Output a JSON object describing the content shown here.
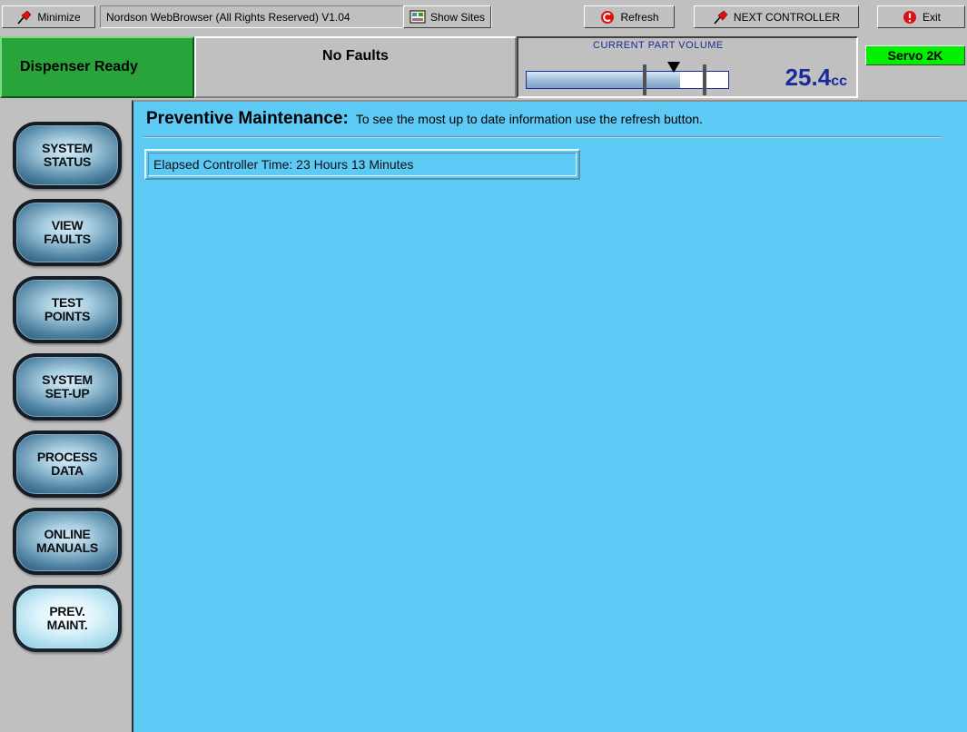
{
  "toolbar": {
    "minimize_label": "Minimize",
    "browser_title": "Nordson WebBrowser (All Rights Reserved) V1.04",
    "show_sites_label": "Show Sites",
    "refresh_label": "Refresh",
    "next_controller_label": "NEXT CONTROLLER",
    "exit_label": "Exit",
    "icons": {
      "minimize": "pin-icon",
      "show_sites": "sites-icon",
      "refresh": "refresh-icon",
      "next_controller": "pin-icon",
      "exit": "exit-icon"
    }
  },
  "status": {
    "ready_text": "Dispenser Ready",
    "faults_text": "No Faults",
    "volume_label": "CURRENT PART VOLUME",
    "volume_value": "25.4",
    "volume_unit": "cc",
    "volume_fill_fraction": 0.76,
    "lower_limit_fraction": 0.585,
    "upper_limit_fraction": 0.885,
    "pointer_fraction": 0.73,
    "servo_label": "Servo 2K"
  },
  "sidebar": {
    "items": [
      {
        "label": "SYSTEM\nSTATUS",
        "active": false
      },
      {
        "label": "VIEW\nFAULTS",
        "active": false
      },
      {
        "label": "TEST\nPOINTS",
        "active": false
      },
      {
        "label": "SYSTEM\nSET-UP",
        "active": false
      },
      {
        "label": "PROCESS\nDATA",
        "active": false
      },
      {
        "label": "ONLINE\nMANUALS",
        "active": false
      },
      {
        "label": "PREV.\nMAINT.",
        "active": true
      }
    ]
  },
  "main": {
    "title": "Preventive Maintenance:",
    "subtitle": "To see the most up to date information use the refresh button.",
    "elapsed_text": "Elapsed Controller Time: 23 Hours 13 Minutes"
  },
  "colors": {
    "ready_green": "#28a43a",
    "servo_green": "#00f000",
    "main_background": "#5dcaf6",
    "volume_blue": "#1a2a9a"
  }
}
